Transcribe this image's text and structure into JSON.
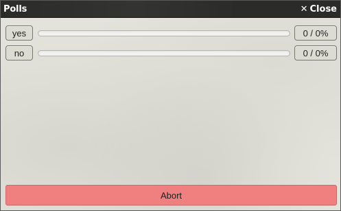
{
  "window": {
    "title": "Polls",
    "close_label": "Close",
    "close_icon": "close-icon"
  },
  "options": [
    {
      "label": "yes",
      "count_text": "0 / 0%",
      "fraction": 0
    },
    {
      "label": "no",
      "count_text": "0 / 0%",
      "fraction": 0
    }
  ],
  "abort_label": "Abort",
  "colors": {
    "titlebar": "#2b2b29",
    "abort": "#f08080",
    "background": "#e3e3dc"
  }
}
